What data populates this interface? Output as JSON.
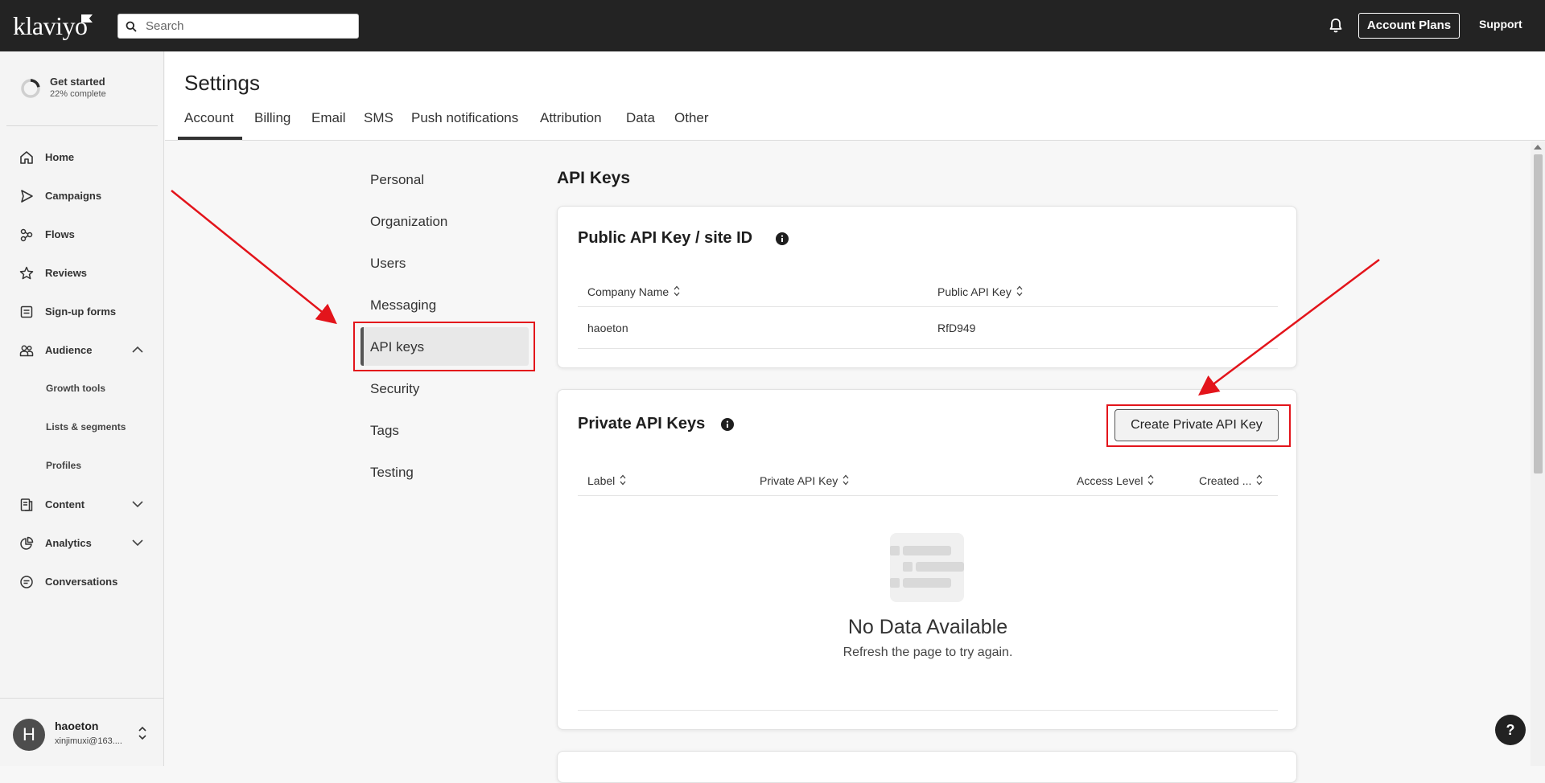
{
  "topbar": {
    "logo": "klaviyo",
    "search_placeholder": "Search",
    "account_plans": "Account Plans",
    "support": "Support"
  },
  "sidebar": {
    "get_started": {
      "title": "Get started",
      "progress": "22% complete",
      "percent": 0.22
    },
    "items": [
      {
        "label": "Home",
        "icon": "home-icon"
      },
      {
        "label": "Campaigns",
        "icon": "campaigns-icon"
      },
      {
        "label": "Flows",
        "icon": "flows-icon"
      },
      {
        "label": "Reviews",
        "icon": "star-icon"
      },
      {
        "label": "Sign-up forms",
        "icon": "form-icon"
      },
      {
        "label": "Audience",
        "icon": "audience-icon",
        "expanded": true
      },
      {
        "label": "Content",
        "icon": "content-icon"
      },
      {
        "label": "Analytics",
        "icon": "analytics-icon"
      },
      {
        "label": "Conversations",
        "icon": "chat-icon"
      }
    ],
    "audience_sub": [
      "Growth tools",
      "Lists & segments",
      "Profiles"
    ],
    "user": {
      "initial": "H",
      "name": "haoeton",
      "email": "xinjimuxi@163...."
    }
  },
  "header": {
    "title": "Settings",
    "tabs": [
      "Account",
      "Billing",
      "Email",
      "SMS",
      "Push notifications",
      "Attribution",
      "Data",
      "Other"
    ],
    "active_tab": "Account"
  },
  "settings_nav": {
    "items": [
      "Personal",
      "Organization",
      "Users",
      "Messaging",
      "API keys",
      "Security",
      "Tags",
      "Testing"
    ],
    "active": "API keys"
  },
  "main": {
    "title": "API Keys",
    "public_card": {
      "title": "Public API Key / site ID",
      "columns": [
        "Company Name",
        "Public API Key"
      ],
      "rows": [
        [
          "haoeton",
          "RfD949"
        ]
      ]
    },
    "private_card": {
      "title": "Private API Keys",
      "create_button": "Create Private API Key",
      "columns": [
        "Label",
        "Private API Key",
        "Access Level",
        "Created ..."
      ],
      "empty_title": "No Data Available",
      "empty_subtitle": "Refresh the page to try again."
    }
  },
  "help": "?",
  "colors": {
    "topbar": "#232323",
    "annotation": "#e3141b"
  }
}
